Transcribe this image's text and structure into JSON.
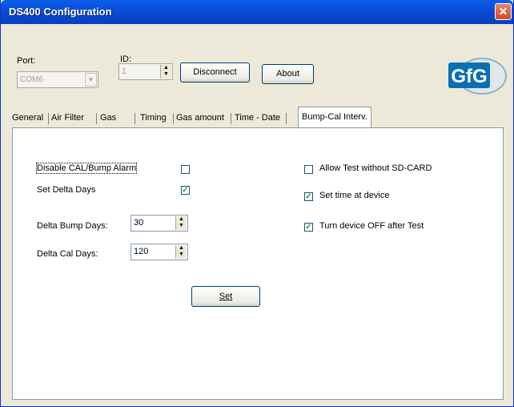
{
  "window": {
    "title": "DS400 Configuration",
    "close_glyph": "✕"
  },
  "connection": {
    "port_label": "Port:",
    "port_value": "COM6",
    "id_label": "ID:",
    "id_value": "1",
    "disconnect_label": "Disconnect",
    "about_label": "About"
  },
  "logo": {
    "text": "GfG"
  },
  "tabs": [
    {
      "label": "General"
    },
    {
      "label": "Air Filter"
    },
    {
      "label": "Gas"
    },
    {
      "label": "Timing"
    },
    {
      "label": "Gas amount"
    },
    {
      "label": "Time - Date"
    },
    {
      "label": "Bump-Cal Interv."
    }
  ],
  "panel": {
    "disable_alarm_label": "Disable CAL/Bump Alarm",
    "disable_alarm_checked": false,
    "set_delta_days_label": "Set Delta Days",
    "set_delta_days_checked": true,
    "delta_bump_label": "Delta Bump Days:",
    "delta_bump_value": "30",
    "delta_cal_label": "Delta Cal Days:",
    "delta_cal_value": "120",
    "set_button_label": "Set",
    "allow_test_label": "Allow Test without SD-CARD",
    "allow_test_checked": false,
    "set_time_label": "Set time at device",
    "set_time_checked": true,
    "turn_off_label": "Turn device OFF after Test",
    "turn_off_checked": true
  },
  "glyphs": {
    "check": "✓",
    "spin": "▲▼",
    "combo": "▼"
  },
  "colors": {
    "titlebar": "#0b4bd6",
    "close": "#d14b2c"
  }
}
